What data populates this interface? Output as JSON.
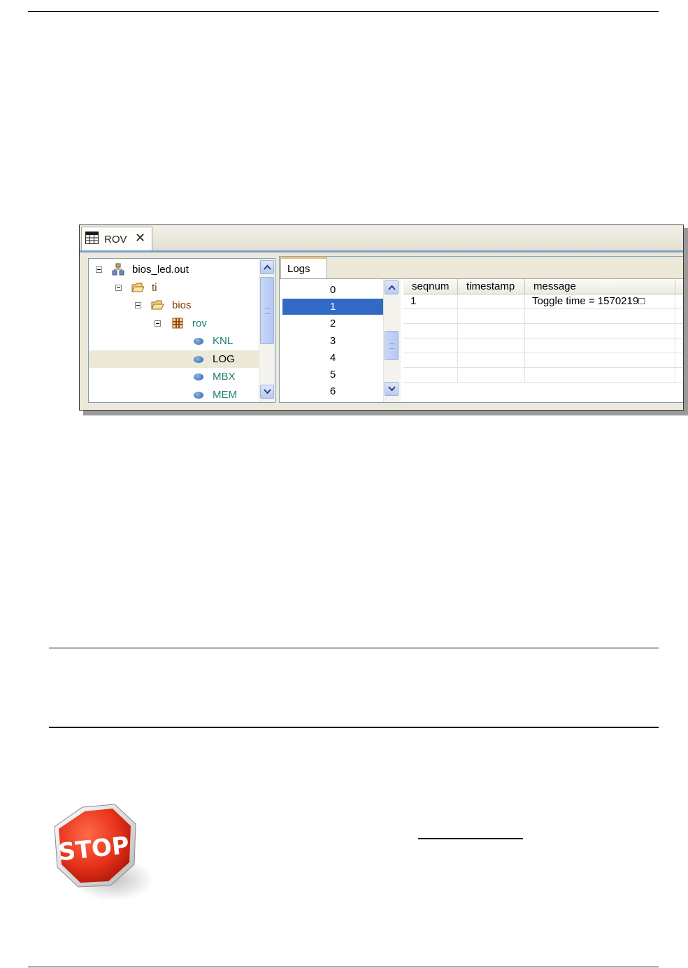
{
  "rov": {
    "tab_label": "ROV",
    "close_glyph": "✕",
    "tree": [
      {
        "label": "bios_led.out",
        "icon": "program-icon",
        "color": "#000000",
        "depth": 0
      },
      {
        "label": "ti",
        "icon": "folder-icon",
        "color": "#7a3b00",
        "depth": 1
      },
      {
        "label": "bios",
        "icon": "folder-icon",
        "color": "#7a3b00",
        "depth": 2
      },
      {
        "label": "rov",
        "icon": "package-icon",
        "color": "#1e7f70",
        "depth": 3
      },
      {
        "label": "KNL",
        "icon": "module-dot-icon",
        "color": "#1e7f70",
        "depth": 4
      },
      {
        "label": "LOG",
        "icon": "module-dot-icon",
        "color": "#000000",
        "depth": 4,
        "selected": true
      },
      {
        "label": "MBX",
        "icon": "module-dot-icon",
        "color": "#1e7f70",
        "depth": 4
      },
      {
        "label": "MEM",
        "icon": "module-dot-icon",
        "color": "#1e7f70",
        "depth": 4
      }
    ],
    "logs": {
      "tab_label": "Logs",
      "indices": [
        "0",
        "1",
        "2",
        "3",
        "4",
        "5",
        "6"
      ],
      "selected_index": "1",
      "columns": [
        "seqnum",
        "timestamp",
        "message"
      ],
      "rows": [
        {
          "seqnum": "1",
          "timestamp": "",
          "message": "Toggle time = 1570219□"
        }
      ]
    }
  },
  "stop_sign": {
    "text": "STOP"
  }
}
